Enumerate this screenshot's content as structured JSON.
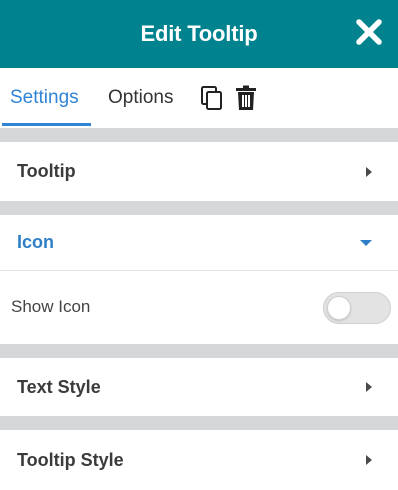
{
  "header": {
    "title": "Edit Tooltip",
    "background_color": "#00838f",
    "close_icon": "close-icon"
  },
  "tabs": {
    "items": [
      {
        "label": "Settings",
        "active": true
      },
      {
        "label": "Options",
        "active": false
      }
    ],
    "actions": [
      {
        "icon": "copy-icon"
      },
      {
        "icon": "trash-icon"
      }
    ],
    "active_color": "#2f84d6"
  },
  "sections": {
    "tooltip": {
      "label": "Tooltip",
      "expanded": false
    },
    "icon": {
      "label": "Icon",
      "expanded": true
    },
    "text_style": {
      "label": "Text Style",
      "expanded": false
    },
    "tooltip_style": {
      "label": "Tooltip Style",
      "expanded": false
    }
  },
  "icon_settings": {
    "show_icon": {
      "label": "Show Icon",
      "value": false
    }
  }
}
